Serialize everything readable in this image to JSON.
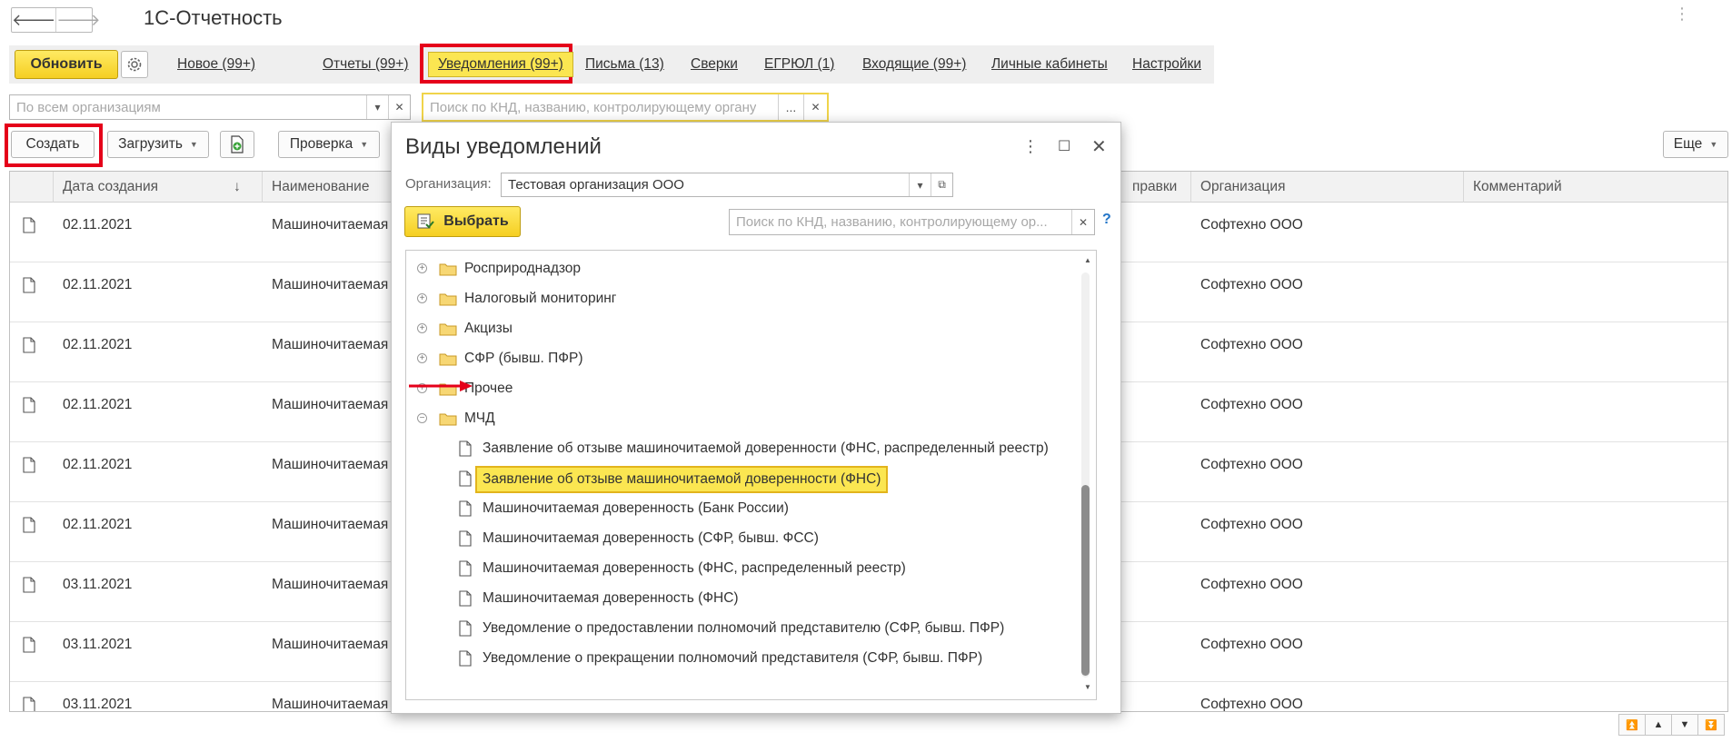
{
  "app": {
    "title": "1С-Отчетность"
  },
  "commandbar": {
    "refresh_label": "Обновить",
    "links": [
      {
        "label": "Новое (99+)"
      },
      {
        "label": "Отчеты (99+)"
      },
      {
        "label": "Уведомления (99+)"
      },
      {
        "label": "Письма (13)"
      },
      {
        "label": "Сверки"
      },
      {
        "label": "ЕГРЮЛ (1)"
      },
      {
        "label": "Входящие (99+)"
      },
      {
        "label": "Личные кабинеты"
      },
      {
        "label": "Настройки"
      }
    ]
  },
  "filters": {
    "org_placeholder": "По всем организациям",
    "search_placeholder": "Поиск по КНД, названию, контролирующему органу",
    "dots": "..."
  },
  "toolbar": {
    "create_label": "Создать",
    "load_label": "Загрузить",
    "check_label": "Проверка",
    "more_label": "Еще"
  },
  "table": {
    "columns": {
      "date": "Дата создания",
      "name": "Наименование",
      "certificate_partial": "правки",
      "org": "Организация",
      "comment": "Комментарий"
    },
    "rows": [
      {
        "date": "02.11.2021",
        "name": "Машиночитаемая д",
        "org": "Софтехно ООО"
      },
      {
        "date": "02.11.2021",
        "name": "Машиночитаемая д",
        "org": "Софтехно ООО"
      },
      {
        "date": "02.11.2021",
        "name": "Машиночитаемая д",
        "org": "Софтехно ООО"
      },
      {
        "date": "02.11.2021",
        "name": "Машиночитаемая д",
        "org": "Софтехно ООО"
      },
      {
        "date": "02.11.2021",
        "name": "Машиночитаемая д",
        "org": "Софтехно ООО"
      },
      {
        "date": "02.11.2021",
        "name": "Машиночитаемая д",
        "org": "Софтехно ООО"
      },
      {
        "date": "03.11.2021",
        "name": "Машиночитаемая д",
        "org": "Софтехно ООО"
      },
      {
        "date": "03.11.2021",
        "name": "Машиночитаемая д",
        "org": "Софтехно ООО"
      },
      {
        "date": "03.11.2021",
        "name": "Машиночитаемая д",
        "org": "Софтехно ООО"
      }
    ]
  },
  "dialog": {
    "title": "Виды уведомлений",
    "org_label": "Организация:",
    "org_value": "Тестовая организация ООО",
    "select_label": "Выбрать",
    "search_placeholder": "Поиск по КНД, названию, контролирующему ор...",
    "help": "?",
    "tree": [
      {
        "type": "folder",
        "expander": "+",
        "label": "Росприроднадзор"
      },
      {
        "type": "folder",
        "expander": "+",
        "label": "Налоговый мониторинг"
      },
      {
        "type": "folder",
        "expander": "+",
        "label": "Акцизы"
      },
      {
        "type": "folder",
        "expander": "+",
        "label": "СФР (бывш. ПФР)"
      },
      {
        "type": "folder",
        "expander": "+",
        "label": "Прочее"
      },
      {
        "type": "folder",
        "expander": "−",
        "label": "МЧД"
      },
      {
        "type": "doc",
        "label": "Заявление об отзыве машиночитаемой доверенности (ФНС, распределенный реестр)"
      },
      {
        "type": "doc",
        "label": "Заявление об отзыве машиночитаемой доверенности (ФНС)",
        "selected": true
      },
      {
        "type": "doc",
        "label": "Машиночитаемая доверенность (Банк России)"
      },
      {
        "type": "doc",
        "label": "Машиночитаемая доверенность (СФР, бывш. ФСС)"
      },
      {
        "type": "doc",
        "label": "Машиночитаемая доверенность (ФНС, распределенный реестр)"
      },
      {
        "type": "doc",
        "label": "Машиночитаемая доверенность (ФНС)"
      },
      {
        "type": "doc",
        "label": "Уведомление о предоставлении полномочий представителю (СФР, бывш. ПФР)"
      },
      {
        "type": "doc",
        "label": "Уведомление о прекращении полномочий представителя (СФР, бывш. ПФР)"
      }
    ]
  },
  "colors": {
    "accent_yellow": "#f5cf22",
    "highlight_red": "#e5001a",
    "selected_row": "#fbe651"
  }
}
